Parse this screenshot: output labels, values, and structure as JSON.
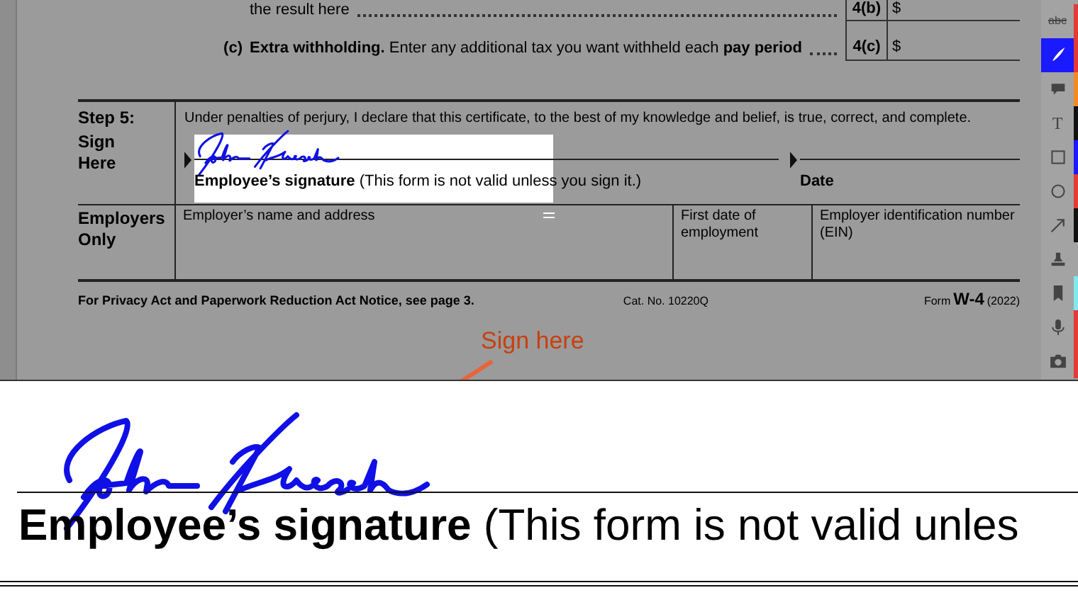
{
  "form": {
    "line_4b": {
      "text": "the result here",
      "field_label": "4(b)",
      "field_value": "$"
    },
    "line_4c": {
      "letter": "(c)",
      "text": "**Extra withholding.** Enter any additional tax you want withheld each **pay period**",
      "field_label": "4(c)",
      "field_value": "$"
    },
    "step5": {
      "heading": "Step 5:",
      "subheading": "Sign Here",
      "declaration": "Under penalties of perjury, I declare that this certificate, to the best of my knowledge and belief, is true, correct, and complete.",
      "signature_label": "**Employee’s signature** (This form is not valid unless you sign it.)",
      "date_label": "Date"
    },
    "employers_only": {
      "heading": "Employers Only",
      "columns": [
        "Employer’s name and address",
        "First date of employment",
        "Employer identification number (EIN)"
      ]
    },
    "footer": {
      "notice": "For Privacy Act and Paperwork Reduction Act Notice, see page 3.",
      "cat_no": "Cat. No. 10220Q",
      "form_word": "Form",
      "form_name": "W-4",
      "form_year": "(2022)"
    }
  },
  "callout": {
    "text": "Sign here"
  },
  "magnifier": {
    "signature_label": "**Employee’s signature** (This form is not valid unles"
  },
  "toolbar": {
    "tools": [
      {
        "kind": "strikethrough",
        "label": "abc",
        "selected": false,
        "color": "#e53935"
      },
      {
        "kind": "pen",
        "selected": true,
        "color": "#e53935"
      },
      {
        "kind": "comment",
        "selected": false,
        "color": "#f08a24"
      },
      {
        "kind": "text",
        "label": "T",
        "selected": false,
        "color": "#111111"
      },
      {
        "kind": "rectangle",
        "selected": false,
        "color": "#1a1aff"
      },
      {
        "kind": "circle",
        "selected": false,
        "color": "#e53935"
      },
      {
        "kind": "arrow",
        "selected": false,
        "color": "#111111"
      },
      {
        "kind": "stamp",
        "selected": false
      },
      {
        "kind": "bookmark",
        "selected": false,
        "color": "#7fe8f0"
      },
      {
        "kind": "microphone",
        "selected": false,
        "color": "#e53935"
      },
      {
        "kind": "camera",
        "selected": false,
        "color": "#e53935"
      }
    ]
  }
}
